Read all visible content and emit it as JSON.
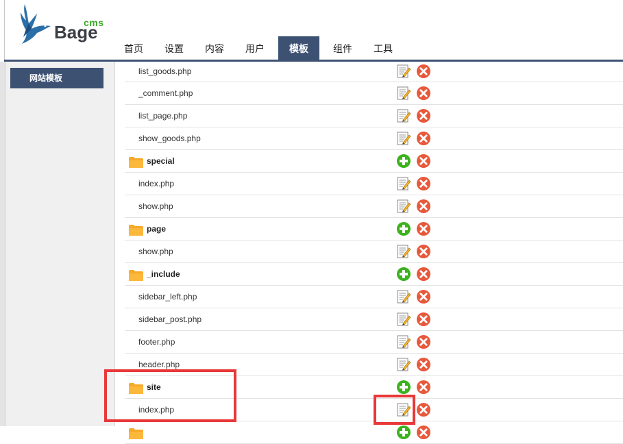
{
  "logo": {
    "brand": "Bage",
    "suffix": "cms"
  },
  "nav": [
    "首页",
    "设置",
    "内容",
    "用户",
    "模板",
    "组件",
    "工具"
  ],
  "nav_active_index": 4,
  "sidebar": {
    "items": [
      {
        "label": "网站模板"
      }
    ]
  },
  "colors": {
    "accent": "#3d5172",
    "add": "#3db21e",
    "delete": "#e8583a",
    "highlight": "#e8383a",
    "folder": "#f39a1e"
  },
  "files": [
    {
      "name": "list_goods.php",
      "type": "file"
    },
    {
      "name": "_comment.php",
      "type": "file"
    },
    {
      "name": "list_page.php",
      "type": "file"
    },
    {
      "name": "show_goods.php",
      "type": "file"
    },
    {
      "name": "special",
      "type": "folder"
    },
    {
      "name": "index.php",
      "type": "file"
    },
    {
      "name": "show.php",
      "type": "file"
    },
    {
      "name": "page",
      "type": "folder"
    },
    {
      "name": "show.php",
      "type": "file"
    },
    {
      "name": "_include",
      "type": "folder"
    },
    {
      "name": "sidebar_left.php",
      "type": "file"
    },
    {
      "name": "sidebar_post.php",
      "type": "file"
    },
    {
      "name": "footer.php",
      "type": "file"
    },
    {
      "name": "header.php",
      "type": "file"
    },
    {
      "name": "site",
      "type": "folder"
    },
    {
      "name": "index.php",
      "type": "file"
    },
    {
      "name": "",
      "type": "folder"
    }
  ]
}
